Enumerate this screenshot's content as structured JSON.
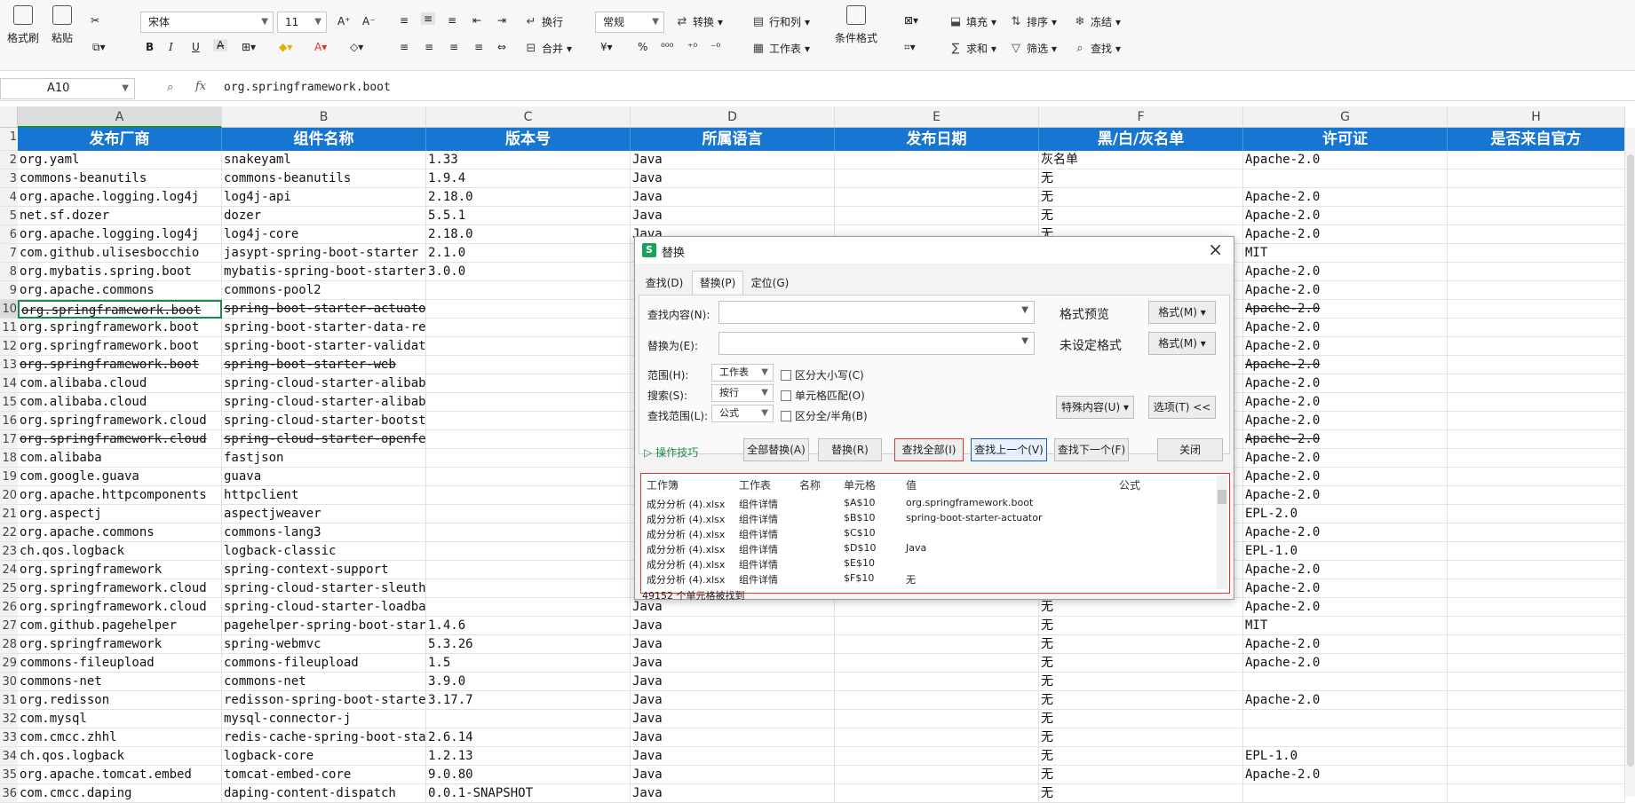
{
  "ribbon": {
    "format_painter": "格式刷",
    "paste": "粘贴",
    "font_name": "宋体",
    "font_size": "11",
    "bold": "B",
    "italic": "I",
    "underline": "U",
    "wrap": "换行",
    "merge": "合并",
    "number_format": "常规",
    "convert": "转换",
    "rows_cols": "行和列",
    "worksheet": "工作表",
    "cond_format": "条件格式",
    "fill": "填充",
    "sort": "排序",
    "freeze": "冻结",
    "sum": "求和",
    "filter": "筛选",
    "find": "查找"
  },
  "formula_bar": {
    "name_box": "A10",
    "fx": "fx",
    "formula": "org.springframework.boot"
  },
  "columns": [
    "A",
    "B",
    "C",
    "D",
    "E",
    "F",
    "G",
    "H"
  ],
  "header_row": [
    "发布厂商",
    "组件名称",
    "版本号",
    "所属语言",
    "发布日期",
    "黑/白/灰名单",
    "许可证",
    "是否来自官方"
  ],
  "row_numbers": [
    "1",
    "2",
    "3",
    "4",
    "5",
    "6",
    "7",
    "8",
    "9",
    "10",
    "11",
    "12",
    "13",
    "14",
    "15",
    "16",
    "17",
    "18",
    "19",
    "20",
    "21",
    "22",
    "23",
    "24",
    "25",
    "26",
    "27",
    "28",
    "29",
    "30",
    "31",
    "32",
    "33",
    "34",
    "35",
    "36"
  ],
  "rows": [
    [
      "org.yaml",
      "snakeyaml",
      "1.33",
      "Java",
      "",
      "灰名单",
      "Apache-2.0",
      "",
      false
    ],
    [
      "commons-beanutils",
      "commons-beanutils",
      "1.9.4",
      "Java",
      "",
      "无",
      "",
      "",
      false
    ],
    [
      "org.apache.logging.log4j",
      "log4j-api",
      "2.18.0",
      "Java",
      "",
      "无",
      "Apache-2.0",
      "",
      false
    ],
    [
      "net.sf.dozer",
      "dozer",
      "5.5.1",
      "Java",
      "",
      "无",
      "Apache-2.0",
      "",
      false
    ],
    [
      "org.apache.logging.log4j",
      "log4j-core",
      "2.18.0",
      "Java",
      "",
      "无",
      "Apache-2.0",
      "",
      false
    ],
    [
      "com.github.ulisesbocchio",
      "jasypt-spring-boot-starter",
      "2.1.0",
      "",
      "",
      "",
      "MIT",
      "",
      false
    ],
    [
      "org.mybatis.spring.boot",
      "mybatis-spring-boot-starter",
      "3.0.0",
      "",
      "",
      "",
      "Apache-2.0",
      "",
      false
    ],
    [
      "org.apache.commons",
      "commons-pool2",
      "",
      "",
      "",
      "",
      "Apache-2.0",
      "",
      false
    ],
    [
      "org.springframework.boot",
      "spring-boot-starter-actuator",
      "",
      "",
      "",
      "",
      "Apache-2.0",
      "",
      true
    ],
    [
      "org.springframework.boot",
      "spring-boot-starter-data-redis",
      "",
      "",
      "",
      "",
      "Apache-2.0",
      "",
      false
    ],
    [
      "org.springframework.boot",
      "spring-boot-starter-validation",
      "",
      "",
      "",
      "",
      "Apache-2.0",
      "",
      false
    ],
    [
      "org.springframework.boot",
      "spring-boot-starter-web",
      "",
      "",
      "",
      "",
      "Apache-2.0",
      "",
      true
    ],
    [
      "com.alibaba.cloud",
      "spring-cloud-starter-alibaba",
      "",
      "",
      "",
      "",
      "Apache-2.0",
      "",
      false
    ],
    [
      "com.alibaba.cloud",
      "spring-cloud-starter-alibaba",
      "",
      "",
      "",
      "",
      "Apache-2.0",
      "",
      false
    ],
    [
      "org.springframework.cloud",
      "spring-cloud-starter-bootstrap",
      "",
      "",
      "",
      "",
      "Apache-2.0",
      "",
      false
    ],
    [
      "org.springframework.cloud",
      "spring-cloud-starter-openfeign",
      "",
      "",
      "",
      "",
      "Apache-2.0",
      "",
      true
    ],
    [
      "com.alibaba",
      "fastjson",
      "",
      "",
      "",
      "",
      "Apache-2.0",
      "",
      false
    ],
    [
      "com.google.guava",
      "guava",
      "",
      "",
      "",
      "",
      "Apache-2.0",
      "",
      false
    ],
    [
      "org.apache.httpcomponents",
      "httpclient",
      "",
      "",
      "",
      "",
      "Apache-2.0",
      "",
      false
    ],
    [
      "org.aspectj",
      "aspectjweaver",
      "",
      "",
      "",
      "",
      "EPL-2.0",
      "",
      false
    ],
    [
      "org.apache.commons",
      "commons-lang3",
      "",
      "",
      "",
      "",
      "Apache-2.0",
      "",
      false
    ],
    [
      "ch.qos.logback",
      "logback-classic",
      "",
      "",
      "",
      "",
      "EPL-1.0",
      "",
      false
    ],
    [
      "org.springframework",
      "spring-context-support",
      "",
      "",
      "",
      "",
      "Apache-2.0",
      "",
      false
    ],
    [
      "org.springframework.cloud",
      "spring-cloud-starter-sleuth",
      "",
      "",
      "",
      "",
      "Apache-2.0",
      "",
      false
    ],
    [
      "org.springframework.cloud",
      "spring-cloud-starter-loadbalancer",
      "",
      "Java",
      "",
      "无",
      "Apache-2.0",
      "",
      false
    ],
    [
      "com.github.pagehelper",
      "pagehelper-spring-boot-starter",
      "1.4.6",
      "Java",
      "",
      "无",
      "MIT",
      "",
      false
    ],
    [
      "org.springframework",
      "spring-webmvc",
      "5.3.26",
      "Java",
      "",
      "无",
      "Apache-2.0",
      "",
      false
    ],
    [
      "commons-fileupload",
      "commons-fileupload",
      "1.5",
      "Java",
      "",
      "无",
      "Apache-2.0",
      "",
      false
    ],
    [
      "commons-net",
      "commons-net",
      "3.9.0",
      "Java",
      "",
      "无",
      "",
      "",
      false
    ],
    [
      "org.redisson",
      "redisson-spring-boot-starter",
      "3.17.7",
      "Java",
      "",
      "无",
      "Apache-2.0",
      "",
      false
    ],
    [
      "com.mysql",
      "mysql-connector-j",
      "",
      "Java",
      "",
      "无",
      "",
      "",
      false
    ],
    [
      "com.cmcc.zhhl",
      "redis-cache-spring-boot-starter",
      "2.6.14",
      "Java",
      "",
      "无",
      "",
      "",
      false
    ],
    [
      "ch.qos.logback",
      "logback-core",
      "1.2.13",
      "Java",
      "",
      "无",
      "EPL-1.0",
      "",
      false
    ],
    [
      "org.apache.tomcat.embed",
      "tomcat-embed-core",
      "9.0.80",
      "Java",
      "",
      "无",
      "Apache-2.0",
      "",
      false
    ],
    [
      "com.cmcc.daping",
      "daping-content-dispatch",
      "0.0.1-SNAPSHOT",
      "Java",
      "",
      "无",
      "",
      "",
      false
    ]
  ],
  "dialog": {
    "title": "替换",
    "tabs": [
      "查找(D)",
      "替换(P)",
      "定位(G)"
    ],
    "find_label": "查找内容(N):",
    "replace_label": "替换为(E):",
    "format_preview": "格式预览",
    "format_unset": "未设定格式",
    "format_btn": "格式(M)",
    "scope_label": "范围(H):",
    "scope_value": "工作表",
    "search_label": "搜索(S):",
    "search_value": "按行",
    "lookin_label": "查找范围(L):",
    "lookin_value": "公式",
    "match_case": "区分大小写(C)",
    "match_cell": "单元格匹配(O)",
    "match_width": "区分全/半角(B)",
    "special": "特殊内容(U)",
    "options": "选项(T) <<",
    "tips": "操作技巧",
    "replace_all": "全部替换(A)",
    "replace": "替换(R)",
    "find_all": "查找全部(I)",
    "find_prev": "查找上一个(V)",
    "find_next": "查找下一个(F)",
    "close": "关闭",
    "result_headers": [
      "工作簿",
      "工作表",
      "名称",
      "单元格",
      "值",
      "公式"
    ],
    "results": [
      [
        "成分分析 (4).xlsx",
        "组件详情",
        "",
        "$A$10",
        "org.springframework.boot"
      ],
      [
        "成分分析 (4).xlsx",
        "组件详情",
        "",
        "$B$10",
        "spring-boot-starter-actuator"
      ],
      [
        "成分分析 (4).xlsx",
        "组件详情",
        "",
        "$C$10",
        ""
      ],
      [
        "成分分析 (4).xlsx",
        "组件详情",
        "",
        "$D$10",
        "Java"
      ],
      [
        "成分分析 (4).xlsx",
        "组件详情",
        "",
        "$E$10",
        ""
      ],
      [
        "成分分析 (4).xlsx",
        "组件详情",
        "",
        "$F$10",
        "无"
      ]
    ],
    "status": "49152 个单元格被找到"
  }
}
